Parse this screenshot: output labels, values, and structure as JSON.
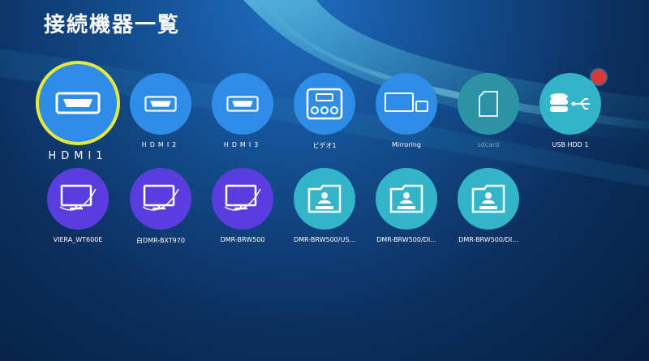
{
  "page": {
    "title": "接続機器一覧"
  },
  "colors": {
    "focus_ring": "#e4e93c",
    "blue_tile": "#2e8de6",
    "teal_tile": "#33b4c8",
    "purple_tile": "#5a3ddf"
  },
  "devices_row1": [
    {
      "label": "HDMI1",
      "icon": "hdmi-icon"
    },
    {
      "label": "HDMI2",
      "icon": "hdmi-icon"
    },
    {
      "label": "HDMI3",
      "icon": "hdmi-icon"
    },
    {
      "label": "ビデオ1",
      "icon": "video-input-icon"
    },
    {
      "label": "Mirroring",
      "icon": "mirroring-icon"
    },
    {
      "label": "sdcard",
      "icon": "sd-card-icon"
    },
    {
      "label": "USB HDD 1",
      "icon": "usb-hdd-icon"
    }
  ],
  "devices_row2": [
    {
      "label": "VIERA_WT600E",
      "icon": "network-tv-icon"
    },
    {
      "label": "白DMR-BXT970",
      "icon": "network-tv-icon"
    },
    {
      "label": "DMR-BRW500",
      "icon": "network-tv-icon"
    },
    {
      "label": "DMR-BRW500/US...",
      "icon": "media-folder-icon"
    },
    {
      "label": "DMR-BRW500/DI...",
      "icon": "media-folder-icon"
    },
    {
      "label": "DMR-BRW500/DI...",
      "icon": "media-folder-icon"
    }
  ]
}
